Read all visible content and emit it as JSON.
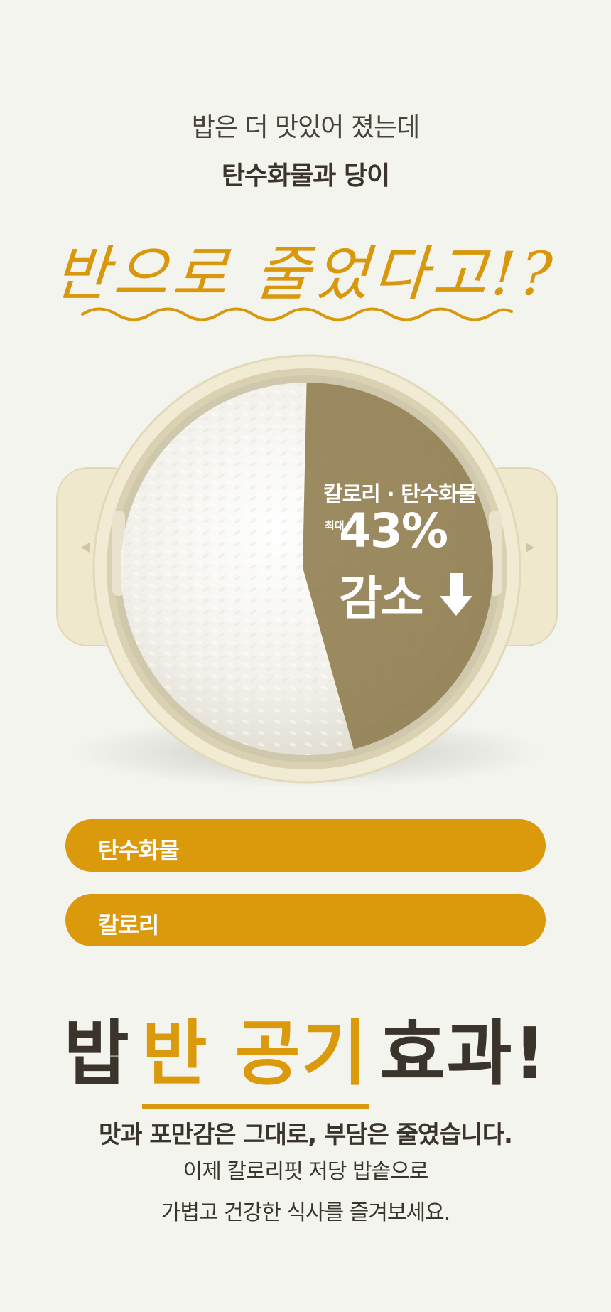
{
  "intro": {
    "line1": "밥은 더 맛있어 졌는데",
    "line2": "탄수화물과 당이"
  },
  "script_headline": "반으로 줄었다고!?",
  "callout": {
    "title": "칼로리 · 탄수화물",
    "prefix": "최대",
    "percent": "43%",
    "decrease": "감소",
    "reduction_fraction": 0.43
  },
  "bars": [
    {
      "label": "탄수화물"
    },
    {
      "label": "칼로리"
    }
  ],
  "headline": {
    "before": "밥",
    "accent": "반 공기",
    "after": "효과!"
  },
  "body": {
    "line1": "맛과 포만감은 그대로, 부담은 줄였습니다.",
    "line2": "이제 칼로리핏 저당 밥솥으로",
    "line3": "가볍고 건강한 식사를 즐겨보세요."
  },
  "colors": {
    "accent": "#da9a0c",
    "background": "#f4f4ef",
    "text_dark": "#3b342d",
    "pot": "#f1ebd4",
    "overlay": "#8c7848"
  }
}
